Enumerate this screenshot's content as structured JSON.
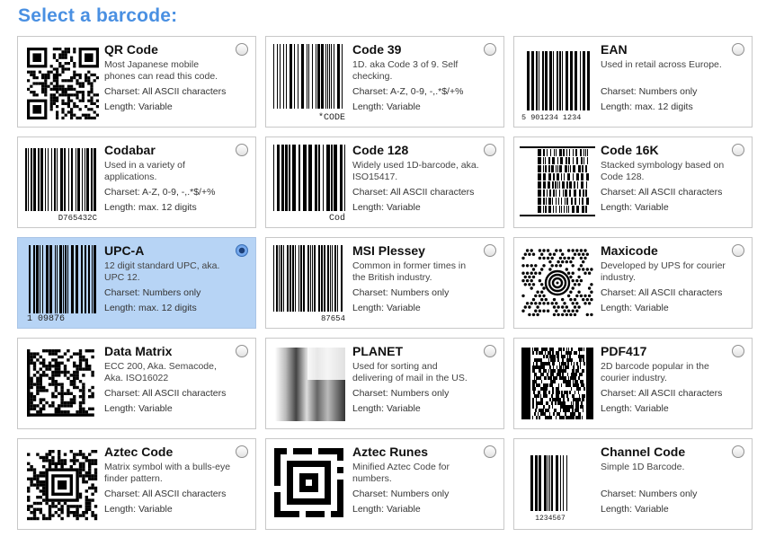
{
  "page": {
    "title": "Select a barcode:"
  },
  "labels": {
    "charset_prefix": "Charset: ",
    "length_prefix": "Length: "
  },
  "barcodes": [
    {
      "name": "QR Code",
      "description": "Most Japanese mobile phones can read this code.",
      "charset": "Charset: All ASCII characters",
      "length": "Length: Variable",
      "selected": false,
      "icon": "qr-code-icon"
    },
    {
      "name": "Code 39",
      "description": "1D. aka Code 3 of 9. Self checking.",
      "charset": "Charset: A-Z, 0-9, -,.*$/+%",
      "length": "Length: Variable",
      "selected": false,
      "icon": "code39-barcode-icon",
      "caption": "*CODE"
    },
    {
      "name": "EAN",
      "description": "Used in retail across Europe.",
      "charset": "Charset: Numbers only",
      "length": "Length: max. 12 digits",
      "selected": false,
      "icon": "ean-barcode-icon",
      "caption": "5 901234 1234"
    },
    {
      "name": "Codabar",
      "description": "Used in a variety of applications.",
      "charset": "Charset: A-Z, 0-9, -,.*$/+%",
      "length": "Length: max. 12 digits",
      "selected": false,
      "icon": "codabar-barcode-icon",
      "caption": "D765432C"
    },
    {
      "name": "Code 128",
      "description": "Widely used 1D-barcode, aka. ISO15417.",
      "charset": "Charset: All ASCII characters",
      "length": "Length: Variable",
      "selected": false,
      "icon": "code128-barcode-icon",
      "caption": "Cod"
    },
    {
      "name": "Code 16K",
      "description": "Stacked symbology based on Code 128.",
      "charset": "Charset: All ASCII characters",
      "length": "Length: Variable",
      "selected": false,
      "icon": "code16k-barcode-icon"
    },
    {
      "name": "UPC-A",
      "description": "12 digit standard UPC, aka. UPC 12.",
      "charset": "Charset: Numbers only",
      "length": "Length: max. 12 digits",
      "selected": true,
      "icon": "upca-barcode-icon",
      "caption": "1 09876"
    },
    {
      "name": "MSI Plessey",
      "description": "Common in former times in the British industry.",
      "charset": "Charset: Numbers only",
      "length": "Length: Variable",
      "selected": false,
      "icon": "msi-plessey-barcode-icon",
      "caption": "87654"
    },
    {
      "name": "Maxicode",
      "description": "Developed by UPS for courier industry.",
      "charset": "Charset: All ASCII characters",
      "length": "Length: Variable",
      "selected": false,
      "icon": "maxicode-icon"
    },
    {
      "name": "Data Matrix",
      "description": "ECC 200, Aka. Semacode, Aka. ISO16022",
      "charset": "Charset: All ASCII characters",
      "length": "Length: Variable",
      "selected": false,
      "icon": "data-matrix-icon"
    },
    {
      "name": "PLANET",
      "description": "Used for sorting and delivering of mail in the US.",
      "charset": "Charset: Numbers only",
      "length": "Length: Variable",
      "selected": false,
      "icon": "planet-barcode-icon"
    },
    {
      "name": "PDF417",
      "description": "2D barcode popular in the courier industry.",
      "charset": "Charset: All ASCII characters",
      "length": "Length: Variable",
      "selected": false,
      "icon": "pdf417-icon"
    },
    {
      "name": "Aztec Code",
      "description": "Matrix symbol with a bulls-eye finder pattern.",
      "charset": "Charset: All ASCII characters",
      "length": "Length: Variable",
      "selected": false,
      "icon": "aztec-code-icon"
    },
    {
      "name": "Aztec Runes",
      "description": "Minified Aztec Code for numbers.",
      "charset": "Charset: Numbers only",
      "length": "Length: Variable",
      "selected": false,
      "icon": "aztec-runes-icon"
    },
    {
      "name": "Channel Code",
      "description": "Simple 1D Barcode.",
      "charset": "Charset: Numbers only",
      "length": "Length: Variable",
      "selected": false,
      "icon": "channel-code-barcode-icon",
      "caption": "1234567"
    }
  ],
  "colors": {
    "title": "#4a90e2",
    "selected_bg": "#b7d4f5",
    "border": "#c8c8c8"
  }
}
